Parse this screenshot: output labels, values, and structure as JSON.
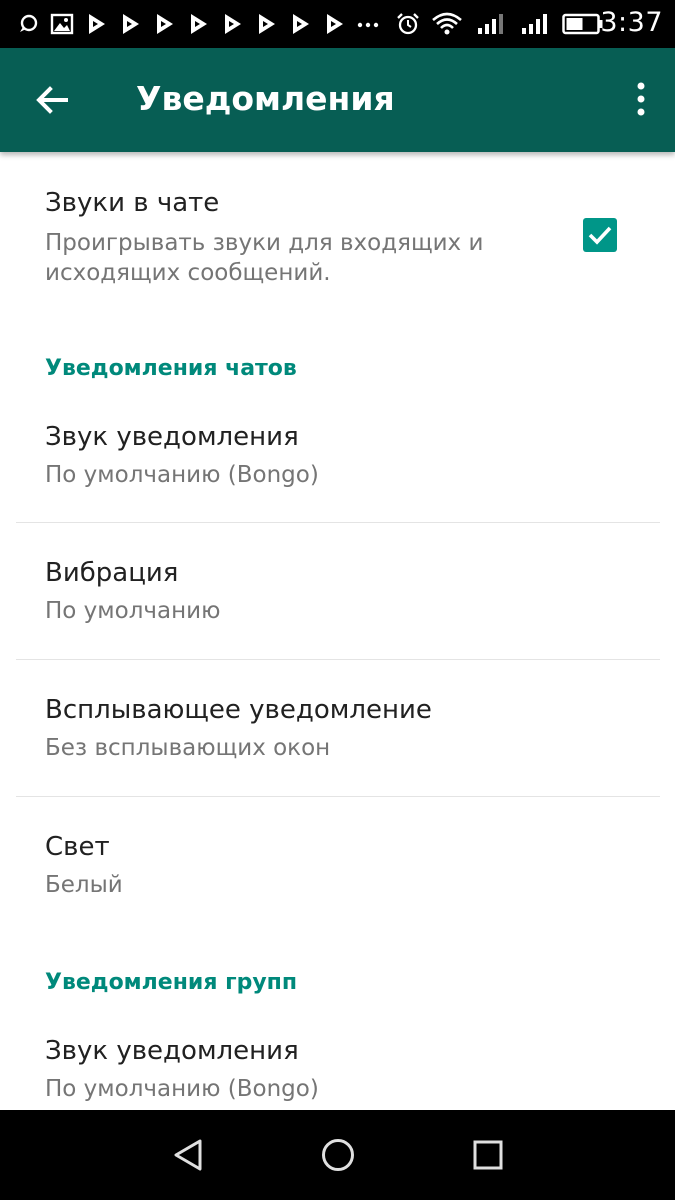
{
  "status_bar": {
    "time": "3:37",
    "icons": [
      "chat-bubble-icon",
      "image-icon",
      "play-store-icon",
      "play-store-icon",
      "play-store-icon",
      "play-store-icon",
      "play-store-icon",
      "play-store-icon",
      "play-store-icon",
      "more-notifications-icon",
      "alarm-icon",
      "wifi-icon",
      "signal-icon",
      "signal-icon",
      "battery-icon"
    ]
  },
  "app_bar": {
    "title": "Уведомления",
    "back_icon": "arrow-back-icon",
    "menu_icon": "more-vert-icon"
  },
  "settings": {
    "chat_sounds": {
      "title": "Звуки в чате",
      "summary_line1": "Проигрывать звуки для входящих и",
      "summary_line2": "исходящих сообщений.",
      "checked": true
    },
    "chat_notifications": {
      "header": "Уведомления чатов",
      "items": [
        {
          "title": "Звук уведомления",
          "summary": "По умолчанию (Bongo)"
        },
        {
          "title": "Вибрация",
          "summary": "По умолчанию"
        },
        {
          "title": "Всплывающее уведомление",
          "summary": "Без всплывающих окон"
        },
        {
          "title": "Свет",
          "summary": "Белый"
        }
      ]
    },
    "group_notifications": {
      "header": "Уведомления групп",
      "items": [
        {
          "title": "Звук уведомления",
          "summary": "По умолчанию (Bongo)"
        }
      ]
    }
  },
  "colors": {
    "app_bar": "#075e54",
    "accent": "#009688",
    "section_header": "#00897b"
  },
  "nav_bar": {
    "icons": [
      "back-triangle-icon",
      "home-circle-icon",
      "recents-square-icon"
    ]
  }
}
